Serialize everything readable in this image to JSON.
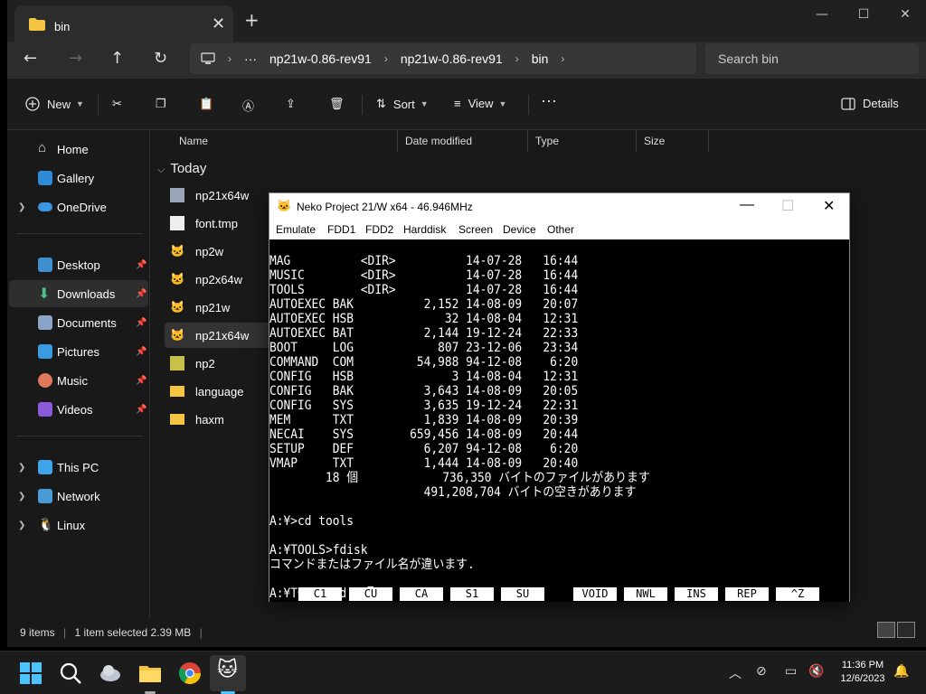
{
  "explorer": {
    "tab_title": "bin",
    "address": [
      "np21w-0.86-rev91",
      "np21w-0.86-rev91",
      "bin"
    ],
    "search_placeholder": "Search bin",
    "commands": {
      "new": "New",
      "sort": "Sort",
      "view": "View",
      "details": "Details"
    },
    "sidebar": {
      "items": [
        {
          "label": "Home",
          "icon": "home-icon"
        },
        {
          "label": "Gallery",
          "icon": "gallery-icon"
        },
        {
          "label": "OneDrive",
          "icon": "cloud-icon"
        },
        {
          "label": "Desktop",
          "icon": "desktop-icon"
        },
        {
          "label": "Downloads",
          "icon": "download-icon"
        },
        {
          "label": "Documents",
          "icon": "documents-icon"
        },
        {
          "label": "Pictures",
          "icon": "pictures-icon"
        },
        {
          "label": "Music",
          "icon": "music-icon"
        },
        {
          "label": "Videos",
          "icon": "videos-icon"
        },
        {
          "label": "This PC",
          "icon": "pc-icon"
        },
        {
          "label": "Network",
          "icon": "network-icon"
        },
        {
          "label": "Linux",
          "icon": "linux-icon"
        }
      ]
    },
    "columns": {
      "name": "Name",
      "date": "Date modified",
      "type": "Type",
      "size": "Size"
    },
    "group": "Today",
    "files": [
      {
        "name": "np21x64w",
        "icon": "config-icon"
      },
      {
        "name": "font.tmp",
        "icon": "file-icon"
      },
      {
        "name": "np2w",
        "icon": "cat-icon"
      },
      {
        "name": "np2x64w",
        "icon": "cat-icon"
      },
      {
        "name": "np21w",
        "icon": "cat-icon"
      },
      {
        "name": "np21x64w",
        "icon": "cat-icon"
      },
      {
        "name": "np2",
        "icon": "config-icon"
      },
      {
        "name": "language",
        "icon": "folder-icon"
      },
      {
        "name": "haxm",
        "icon": "folder-icon"
      }
    ],
    "status": {
      "items": "9 items",
      "selected": "1 item selected  2.39 MB"
    }
  },
  "neko": {
    "title": "Neko Project 21/W x64 - 46.946MHz",
    "menu": [
      "Emulate",
      "FDD1",
      "FDD2",
      "Harddisk",
      "Screen",
      "Device",
      "Other"
    ],
    "terminal": [
      "MAG          <DIR>          14-07-28   16:44",
      "MUSIC        <DIR>          14-07-28   16:44",
      "TOOLS        <DIR>          14-07-28   16:44",
      "AUTOEXEC BAK          2,152 14-08-09   20:07",
      "AUTOEXEC HSB             32 14-08-04   12:31",
      "AUTOEXEC BAT          2,144 19-12-24   22:33",
      "BOOT     LOG            807 23-12-06   23:34",
      "COMMAND  COM         54,988 94-12-08    6:20",
      "CONFIG   HSB              3 14-08-04   12:31",
      "CONFIG   BAK          3,643 14-08-09   20:05",
      "CONFIG   SYS          3,635 19-12-24   22:31",
      "MEM      TXT          1,839 14-08-09   20:39",
      "NECAI    SYS        659,456 14-08-09   20:44",
      "SETUP    DEF          6,207 94-12-08    6:20",
      "VMAP     TXT          1,444 14-08-09   20:40",
      "        18 個            736,350 バイトのファイルがあります",
      "                      491,208,704 バイトの空きがあります",
      "",
      "A:¥>cd tools",
      "",
      "A:¥TOOLS>fdisk",
      "コマンドまたはファイル名が違います.",
      "",
      "A:¥TOOLS>cd .."
    ],
    "fkeys": [
      "C1",
      "CU",
      "CA",
      "S1",
      "SU",
      "VOID",
      "NWL",
      "INS",
      "REP",
      "^Z"
    ]
  },
  "taskbar": {
    "time": "11:36 PM",
    "date": "12/6/2023"
  }
}
